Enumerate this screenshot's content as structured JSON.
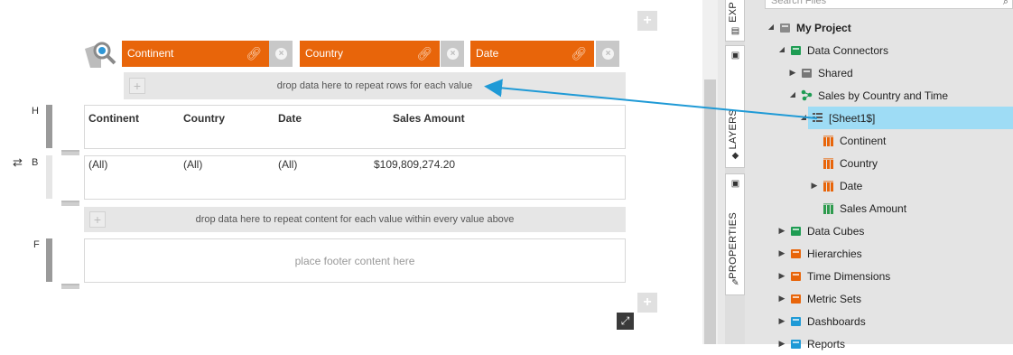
{
  "filters": [
    {
      "label": "Continent"
    },
    {
      "label": "Country"
    },
    {
      "label": "Date"
    }
  ],
  "drop_rows_text": "drop data here to repeat rows for each value",
  "drop_content_text": "drop data here to repeat content for each value within every value above",
  "sections": {
    "header": "H",
    "body": "B",
    "footer": "F"
  },
  "header_cells": [
    "Continent",
    "Country",
    "Date",
    "Sales Amount"
  ],
  "body_cells": [
    "(All)",
    "(All)",
    "(All)",
    "$109,809,274.20"
  ],
  "footer_placeholder": "place footer content here",
  "side_tabs": {
    "explorer": "EXP",
    "layers": "LAYERS",
    "properties": "PROPERTIES"
  },
  "search_placeholder": "Search Files",
  "tree": [
    {
      "label": "My Project",
      "bold": true,
      "arrow": "down",
      "icon": "project-icon"
    },
    {
      "label": "Data Connectors",
      "arrow": "down",
      "icon": "data-connectors-icon"
    },
    {
      "label": "Shared",
      "arrow": "right",
      "icon": "shared-folder-icon"
    },
    {
      "label": "Sales by Country and Time",
      "arrow": "down",
      "icon": "connection-icon"
    },
    {
      "label": "[Sheet1$]",
      "arrow": "down",
      "icon": "table-icon",
      "selected": true
    },
    {
      "label": "Continent",
      "arrow": "",
      "icon": "column-icon"
    },
    {
      "label": "Country",
      "arrow": "",
      "icon": "column-icon"
    },
    {
      "label": "Date",
      "arrow": "right",
      "icon": "date-column-icon"
    },
    {
      "label": "Sales Amount",
      "arrow": "",
      "icon": "numeric-column-icon"
    },
    {
      "label": "Data Cubes",
      "arrow": "right",
      "icon": "data-cubes-icon"
    },
    {
      "label": "Hierarchies",
      "arrow": "right",
      "icon": "hierarchies-icon"
    },
    {
      "label": "Time Dimensions",
      "arrow": "right",
      "icon": "time-dimensions-icon"
    },
    {
      "label": "Metric Sets",
      "arrow": "right",
      "icon": "metric-sets-icon"
    },
    {
      "label": "Dashboards",
      "arrow": "right",
      "icon": "dashboards-icon"
    },
    {
      "label": "Reports",
      "arrow": "right",
      "icon": "reports-icon"
    }
  ],
  "colors": {
    "filter_orange": "#e8650a",
    "selection_blue": "#9edcf5",
    "connector_blue": "#1f9ad6"
  }
}
